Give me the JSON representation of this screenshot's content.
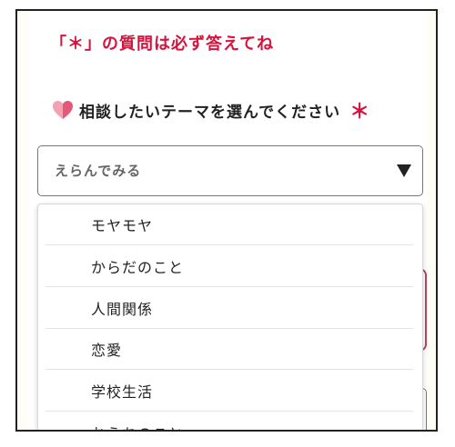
{
  "form": {
    "required_note": "「＊」の質問は必ず答えてね",
    "question": {
      "icon": "heart-icon",
      "label": "相談したいテーマを選んでください",
      "required_mark": "＊"
    },
    "select": {
      "value": "えらんでみる"
    },
    "options": [
      "モヤモヤ",
      "からだのこと",
      "人間関係",
      "恋愛",
      "学校生活",
      "おうちのこと"
    ]
  },
  "colors": {
    "accent": "#d6123d",
    "heart_left": "#f4a2b3",
    "heart_right": "#e4587a",
    "border": "#777777"
  }
}
